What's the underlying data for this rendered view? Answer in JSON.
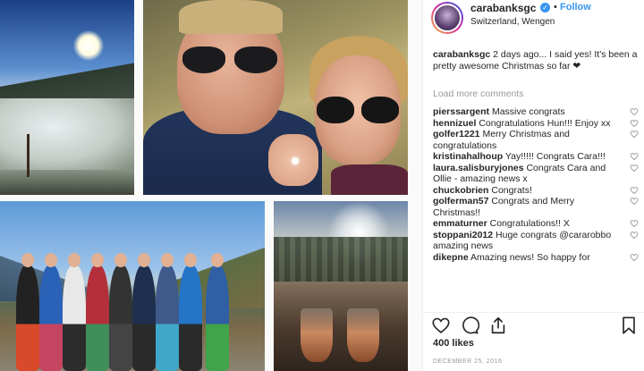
{
  "post": {
    "username": "carabanksgc",
    "verified_glyph": "✓",
    "separator": "•",
    "follow_label": "Follow",
    "location": "Switzerland, Wengen",
    "caption": {
      "username": "carabanksgc",
      "text": "2 days ago... I said yes! It's been a pretty awesome Christmas so far ❤"
    },
    "load_more_label": "Load more comments",
    "comments": [
      {
        "user": "pierssargent",
        "text": "Massive congrats"
      },
      {
        "user": "hennizuel",
        "text": "Congratulations Hun!!! Enjoy xx"
      },
      {
        "user": "golfer1221",
        "text": "Merry Christmas and congratulations"
      },
      {
        "user": "kristinahalhoup",
        "text": "Yay!!!!! Congrats Cara!!!"
      },
      {
        "user": "laura.salisburyjones",
        "text": "Congrats Cara and Ollie - amazing news x"
      },
      {
        "user": "chuckobrien",
        "text": "Congrats!"
      },
      {
        "user": "golferman57",
        "text": "Congrats and Merry Christmas!!"
      },
      {
        "user": "emmaturner",
        "text": "Congratulations!! X"
      },
      {
        "user": "stoppani2012",
        "text": "Huge congrats @cararobbo amazing news"
      },
      {
        "user": "dikepne",
        "text": "Amazing news! So happy for"
      }
    ],
    "likes": "400 likes",
    "date": "DECEMBER 25, 2016"
  },
  "icons": {
    "heart": "heart-icon",
    "like": "like-icon",
    "comment": "comment-icon",
    "share": "share-icon",
    "save": "bookmark-icon"
  },
  "colors": {
    "link_blue": "#3897f0",
    "text": "#262626",
    "muted": "#999999"
  }
}
